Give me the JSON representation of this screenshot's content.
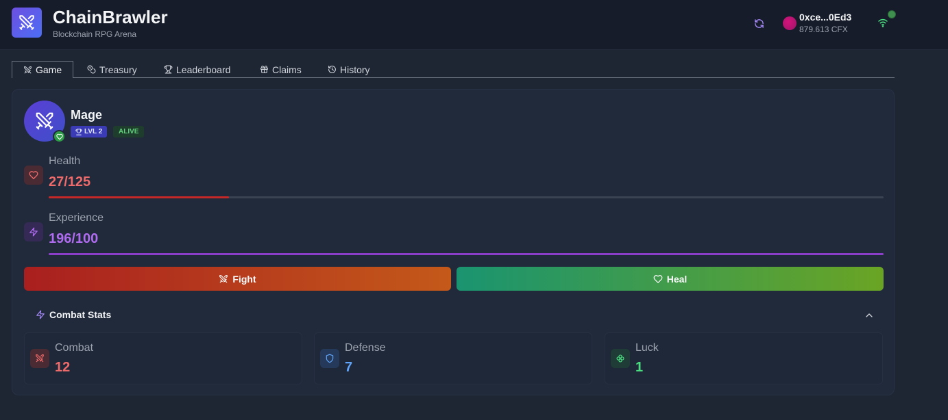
{
  "header": {
    "title": "ChainBrawler",
    "subtitle": "Blockchain RPG Arena",
    "wallet_address": "0xce...0Ed3",
    "wallet_balance": "879.613 CFX",
    "icons": [
      "swords-icon",
      "refresh-icon",
      "wifi-icon"
    ]
  },
  "tabs": [
    {
      "label": "Game",
      "icon": "swords-icon",
      "active": true
    },
    {
      "label": "Treasury",
      "icon": "coins-icon",
      "active": false
    },
    {
      "label": "Leaderboard",
      "icon": "trophy-icon",
      "active": false
    },
    {
      "label": "Claims",
      "icon": "gift-icon",
      "active": false
    },
    {
      "label": "History",
      "icon": "history-icon",
      "active": false
    }
  ],
  "character": {
    "name": "Mage",
    "level_label": "LVL 2",
    "status": "ALIVE"
  },
  "health": {
    "label": "Health",
    "value_text": "27/125",
    "current": 27,
    "max": 125,
    "color": "#ef6b6b"
  },
  "experience": {
    "label": "Experience",
    "value_text": "196/100",
    "current": 196,
    "max": 100,
    "color": "#b06cf0"
  },
  "actions": {
    "fight_label": "Fight",
    "heal_label": "Heal"
  },
  "combat_stats": {
    "title": "Combat Stats",
    "stats": [
      {
        "label": "Combat",
        "value": "12",
        "color": "#ef6b6b",
        "icon": "swords-icon"
      },
      {
        "label": "Defense",
        "value": "7",
        "color": "#60a5fa",
        "icon": "shield-icon"
      },
      {
        "label": "Luck",
        "value": "1",
        "color": "#4ade80",
        "icon": "clover-icon"
      }
    ]
  },
  "colors": {
    "accent_purple": "#6d4fe0",
    "alive_green": "#5ed27a",
    "fight_red": "#a91f1f",
    "heal_green": "#1a9470"
  }
}
